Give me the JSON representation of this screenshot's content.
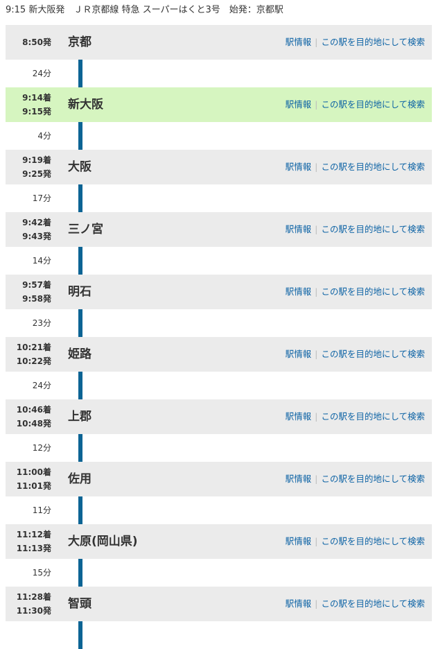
{
  "header": {
    "text": "9:15 新大阪発　ＪＲ京都線 特急 スーパーはくと3号　始発：京都駅"
  },
  "links": {
    "info": "駅情報",
    "sep": "|",
    "dest": "この駅を目的地にして検索"
  },
  "colors": {
    "line": "#0c6494",
    "row_bg": "#ebebeb",
    "current_bg": "#d6f5c0",
    "link": "#0d63a5"
  },
  "stations": [
    {
      "arr": "",
      "dep": "8:50発",
      "name": "京都"
    },
    {
      "arr": "9:14着",
      "dep": "9:15発",
      "name": "新大阪",
      "current": true
    },
    {
      "arr": "9:19着",
      "dep": "9:25発",
      "name": "大阪"
    },
    {
      "arr": "9:42着",
      "dep": "9:43発",
      "name": "三ノ宮"
    },
    {
      "arr": "9:57着",
      "dep": "9:58発",
      "name": "明石"
    },
    {
      "arr": "10:21着",
      "dep": "10:22発",
      "name": "姫路"
    },
    {
      "arr": "10:46着",
      "dep": "10:48発",
      "name": "上郡"
    },
    {
      "arr": "11:00着",
      "dep": "11:01発",
      "name": "佐用"
    },
    {
      "arr": "11:12着",
      "dep": "11:13発",
      "name": "大原(岡山県)"
    },
    {
      "arr": "11:28着",
      "dep": "11:30発",
      "name": "智頭"
    }
  ],
  "segments": [
    "24分",
    "4分",
    "17分",
    "14分",
    "23分",
    "24分",
    "12分",
    "11分",
    "15分",
    ""
  ]
}
